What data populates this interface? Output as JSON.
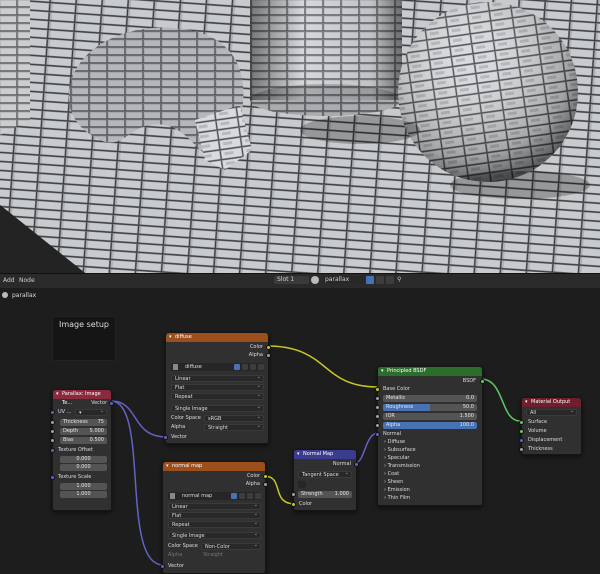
{
  "header": {
    "add": "Add",
    "node": "Node",
    "slot": "Slot 1",
    "material": "parallax",
    "pin": "⚲"
  },
  "breadcrumb": {
    "label": "parallax"
  },
  "frame": {
    "label": "Image setup"
  },
  "nodes": {
    "parallax": {
      "title": "Parallax: Image Te...",
      "output": "Vector",
      "uv": "UV ...",
      "uv_value": "▾",
      "fields": [
        {
          "label": "Thickness",
          "value": "75"
        },
        {
          "label": "Depth",
          "value": "5.000"
        },
        {
          "label": "Bias",
          "value": "0.500"
        }
      ],
      "offset_label": "Texture Offset",
      "offset": [
        "0.000",
        "0.000"
      ],
      "scale_label": "Texture Scale",
      "scale": [
        "1.000",
        "1.000"
      ]
    },
    "diffuse": {
      "title": "diffuse",
      "out_color": "Color",
      "out_alpha": "Alpha",
      "image": "diffuse",
      "interp": "Linear",
      "proj": "Flat",
      "ext": "Repeat",
      "source": "Single Image",
      "cs_label": "Color Space",
      "cs_value": "sRGB",
      "alpha_label": "Alpha",
      "alpha_value": "Straight",
      "in_vector": "Vector"
    },
    "normalimg": {
      "title": "normal map",
      "out_color": "Color",
      "out_alpha": "Alpha",
      "image": "normal map",
      "interp": "Linear",
      "proj": "Flat",
      "ext": "Repeat",
      "source": "Single Image",
      "cs_label": "Color Space",
      "cs_value": "Non-Color",
      "alpha_label": "Alpha",
      "alpha_value": "Straight",
      "in_vector": "Vector"
    },
    "normalmap": {
      "title": "Normal Map",
      "out": "Normal",
      "space": "Tangent Space",
      "strength_label": "Strength",
      "strength": "1.000",
      "in_color": "Color"
    },
    "bsdf": {
      "title": "Principled BSDF",
      "out": "BSDF",
      "base": "Base Color",
      "metallic_label": "Metallic",
      "metallic": "0.0",
      "rough_label": "Roughness",
      "rough": "50.0",
      "ior_label": "IOR",
      "ior": "1.500",
      "alpha_label": "Alpha",
      "alpha": "100.0",
      "normal": "Normal",
      "panels": [
        "Diffuse",
        "Subsurface",
        "Specular",
        "Transmission",
        "Coat",
        "Sheen",
        "Emission",
        "Thin Film"
      ]
    },
    "output": {
      "title": "Material Output",
      "target": "All",
      "sockets": [
        "Surface",
        "Volume",
        "Displacement",
        "Thickness"
      ]
    }
  },
  "colors": {
    "texture_header": "#9b4f1c",
    "shader_header": "#2b6e2b",
    "vector_header": "#3b3b8f",
    "output_header": "#6e1f2b",
    "parallax_header": "#8a2a3e",
    "wire_yellow": "#c7c729",
    "wire_purple": "#6363c7",
    "wire_green": "#63c763"
  }
}
